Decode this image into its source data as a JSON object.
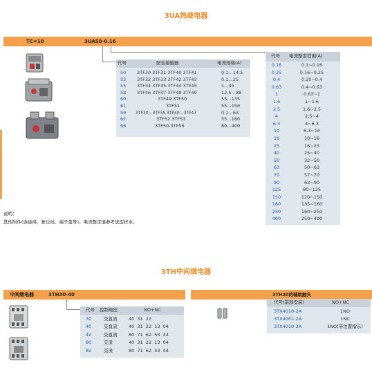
{
  "section1": {
    "title": "3UA热继电器",
    "bar_left": "TC=10",
    "bar_model": "3UA50-0.16",
    "contactor_table": {
      "headers": [
        "代号",
        "配合接触器",
        "电流规格(A)"
      ],
      "rows": [
        {
          "code": "50",
          "contactors": "3TF30  3TF31  3TF40  3TF41",
          "range": "0.1…14.5"
        },
        {
          "code": "52",
          "contactors": "3TF32  3TF33  3TF42  3TF43",
          "range": "0.1…25"
        },
        {
          "code": "55",
          "contactors": "3TF34  3TF35  3TF44  3TF45",
          "range": "1…45"
        },
        {
          "code": "58",
          "contactors": "3TF46  3TF47  3TF48  3TF49",
          "range": "12.5…88"
        },
        {
          "code": "60",
          "contactors": "3TF49  3TF50",
          "range": "55…135"
        },
        {
          "code": "61",
          "contactors": "3TF51",
          "range": "55…150"
        },
        {
          "code": "59",
          "contactors": "3TF30…3TF35  3TF40…3TF47",
          "range": "0.1…63"
        },
        {
          "code": "62",
          "contactors": "3TF52  3TF53",
          "range": "55…180"
        },
        {
          "code": "66",
          "contactors": "3TF50-3TF56",
          "range": "80…400"
        }
      ]
    },
    "current_table": {
      "headers": [
        "代号",
        "电流整定范围(A)"
      ],
      "rows": [
        {
          "code": "0.16",
          "range": "0.1~0.16"
        },
        {
          "code": "0.25",
          "range": "0.16~0.25"
        },
        {
          "code": "0.4",
          "range": "0.25~0.4"
        },
        {
          "code": "0.63",
          "range": "0.4~0.63"
        },
        {
          "code": "1",
          "range": "0.63~1"
        },
        {
          "code": "1.6",
          "range": "1~1.6"
        },
        {
          "code": "2.5",
          "range": "1.6~2.5"
        },
        {
          "code": "4",
          "range": "2.5~4"
        },
        {
          "code": "6.3",
          "range": "4~6.3"
        },
        {
          "code": "10",
          "range": "6.3~10"
        },
        {
          "code": "16",
          "range": "10~16"
        },
        {
          "code": "25",
          "range": "16~25"
        },
        {
          "code": "40",
          "range": "25~40"
        },
        {
          "code": "50",
          "range": "32~50"
        },
        {
          "code": "63",
          "range": "50~63"
        },
        {
          "code": "70",
          "range": "57~70"
        },
        {
          "code": "90",
          "range": "63~90"
        },
        {
          "code": "125",
          "range": "80~125"
        },
        {
          "code": "150",
          "range": "120~150"
        },
        {
          "code": "160",
          "range": "135~160"
        },
        {
          "code": "250",
          "range": "160~250"
        },
        {
          "code": "400",
          "range": "250~400"
        }
      ]
    },
    "note_title": "说明：",
    "note_body": "其他附件(连接排、复位线、端子盖等)，电流整定值参考选型样本。"
  },
  "section2": {
    "title": "3TH中间继电器",
    "bar_left": "中间继电器",
    "bar_model": "3TH30-40",
    "relay_table": {
      "headers": [
        "代号",
        "控制电压",
        "NO+NC"
      ],
      "rows": [
        {
          "code": "30",
          "voltage": "交直流",
          "nonc": "40  31  22"
        },
        {
          "code": "40",
          "voltage": "交直流",
          "nonc": "40  31  22  13  04"
        },
        {
          "code": "42",
          "voltage": "交直流",
          "nonc": "80  71  62  53  44"
        },
        {
          "code": "80",
          "voltage": "交流",
          "nonc": "40  31  22  13  04"
        },
        {
          "code": "82",
          "voltage": "交流",
          "nonc": "80  71  62  53  44"
        }
      ]
    },
    "aux_title": "3TH30的辅助触头",
    "aux_table": {
      "headers": [
        "代号(前部安装)",
        "NO+NC"
      ],
      "rows": [
        {
          "code": "3TX4010-2A",
          "nonc": "1NO"
        },
        {
          "code": "3TX4001-2A",
          "nonc": "1NC"
        },
        {
          "code": "3TX4010-3A",
          "nonc": "1NO(带位置指示)"
        }
      ]
    }
  },
  "colors": {
    "accent": "#f5a04a",
    "title": "#f28c28",
    "code_blue": "#1a59b0",
    "table_bg": "#dfe6ec",
    "header_bg": "#c9d2da"
  }
}
